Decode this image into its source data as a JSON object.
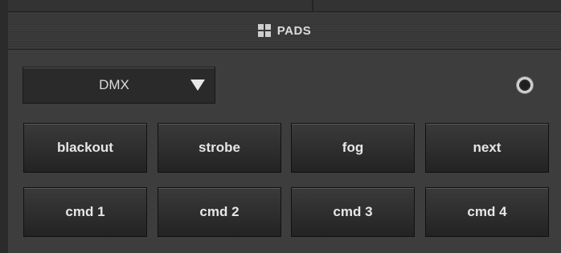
{
  "header": {
    "title": "PADS",
    "icon": "grid-icon"
  },
  "dropdown": {
    "selected": "DMX",
    "icon": "dropdown-triangle-icon"
  },
  "indicator": {
    "icon": "led-indicator-icon"
  },
  "pads": [
    {
      "label": "blackout"
    },
    {
      "label": "strobe"
    },
    {
      "label": "fog"
    },
    {
      "label": "next"
    },
    {
      "label": "cmd 1"
    },
    {
      "label": "cmd 2"
    },
    {
      "label": "cmd 3"
    },
    {
      "label": "cmd 4"
    }
  ]
}
